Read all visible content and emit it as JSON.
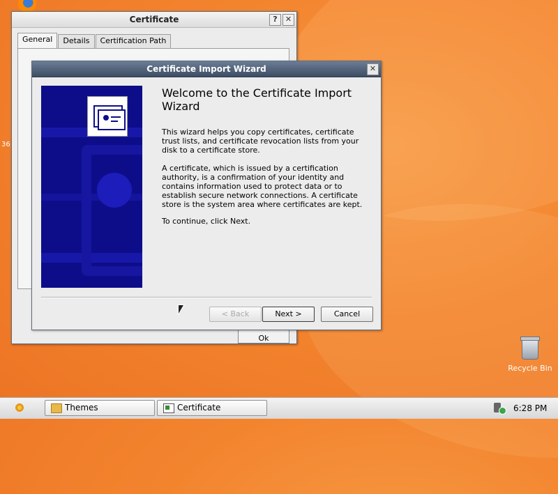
{
  "desktop": {
    "side_number": "36",
    "recycle_bin_label": "Recycle Bin"
  },
  "certificate_window": {
    "title": "Certificate",
    "help_label": "?",
    "close_label": "✕",
    "tabs": [
      {
        "label": "General",
        "active": true
      },
      {
        "label": "Details",
        "active": false
      },
      {
        "label": "Certification Path",
        "active": false
      }
    ],
    "ok_label": "Ok"
  },
  "wizard": {
    "title": "Certificate Import Wizard",
    "close_label": "✕",
    "heading": "Welcome to the Certificate Import Wizard",
    "paragraph1": "This wizard helps you copy certificates, certificate trust lists, and certificate revocation lists from your disk to a certificate store.",
    "paragraph2": "A certificate, which is issued by a certification authority, is a confirmation of your identity and contains information used to protect data or to establish secure network connections. A certificate store is the system area where certificates are kept.",
    "paragraph3": "To continue, click Next.",
    "buttons": {
      "back": "< Back",
      "next": "Next >",
      "cancel": "Cancel"
    }
  },
  "taskbar": {
    "tasks": [
      {
        "label": "Themes",
        "icon": "folder-icon"
      },
      {
        "label": "Certificate",
        "icon": "certificate-icon"
      }
    ],
    "clock": "6:28 PM"
  }
}
